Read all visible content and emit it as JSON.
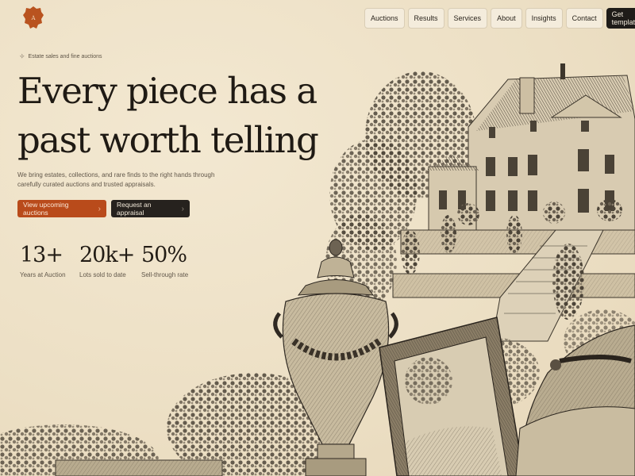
{
  "nav": {
    "items": [
      {
        "label": "Auctions"
      },
      {
        "label": "Results"
      },
      {
        "label": "Services"
      },
      {
        "label": "About"
      },
      {
        "label": "Insights"
      },
      {
        "label": "Contact"
      }
    ],
    "cta_label": "Get template"
  },
  "hero": {
    "eyebrow": "Estate sales and fine auctions",
    "headline_line1": "Every piece has a",
    "headline_line2": "past worth telling",
    "subtext": "We bring estates, collections, and rare finds to the right hands through carefully curated auctions and trusted appraisals.",
    "primary_button": "View upcoming auctions",
    "secondary_button": "Request an appraisal"
  },
  "stats": [
    {
      "value": "13+",
      "label": "Years at Auction"
    },
    {
      "value": "20k+",
      "label": "Lots sold to date"
    },
    {
      "value": "50%",
      "label": "Sell-through rate"
    }
  ],
  "colors": {
    "background": "#efe3ca",
    "accent": "#b94b1b",
    "dark": "#1f1c19",
    "ink": "#2a2218"
  }
}
